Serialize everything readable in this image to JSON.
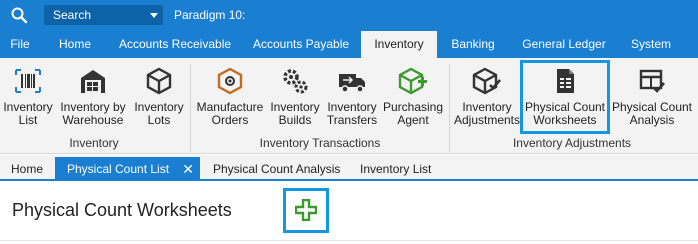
{
  "titlebar": {
    "search_label": "Search",
    "company_name": "Paradigm 10:",
    "bar_color": "#1a7fd0"
  },
  "menu": {
    "tabs": [
      {
        "label": "File"
      },
      {
        "label": "Home"
      },
      {
        "label": "Accounts Receivable"
      },
      {
        "label": "Accounts Payable"
      },
      {
        "label": "Inventory",
        "active": true
      },
      {
        "label": "Banking"
      },
      {
        "label": "General Ledger"
      },
      {
        "label": "System"
      }
    ]
  },
  "ribbon": {
    "groups": [
      {
        "label": "Inventory"
      },
      {
        "label": "Inventory Transactions"
      },
      {
        "label": "Inventory Adjustments"
      }
    ],
    "buttons": {
      "inventory_list": {
        "line1": "Inventory",
        "line2": "List",
        "icon": "barcode-icon"
      },
      "inventory_by_warehouse": {
        "line1": "Inventory by",
        "line2": "Warehouse",
        "icon": "warehouse-icon"
      },
      "inventory_lots": {
        "line1": "Inventory",
        "line2": "Lots",
        "icon": "box-icon"
      },
      "manufacture_orders": {
        "line1": "Manufacture",
        "line2": "Orders",
        "icon": "gear-box-icon"
      },
      "inventory_builds": {
        "line1": "Inventory",
        "line2": "Builds",
        "icon": "gears-icon"
      },
      "inventory_transfers": {
        "line1": "Inventory",
        "line2": "Transfers",
        "icon": "truck-icon"
      },
      "purchasing_agent": {
        "line1": "Purchasing",
        "line2": "Agent",
        "icon": "box-plus-icon"
      },
      "inventory_adjustments": {
        "line1": "Inventory",
        "line2": "Adjustments",
        "icon": "box-check-icon"
      },
      "physical_count_worksheets": {
        "line1": "Physical Count",
        "line2": "Worksheets",
        "icon": "worksheet-icon"
      },
      "physical_count_analysis": {
        "line1": "Physical Count",
        "line2": "Analysis",
        "icon": "table-check-icon"
      }
    }
  },
  "doc_tabs": [
    {
      "label": "Home"
    },
    {
      "label": "Physical Count List",
      "active": true,
      "close": "✕"
    },
    {
      "label": "Physical Count Analysis"
    },
    {
      "label": "Inventory List"
    }
  ],
  "content": {
    "title": "Physical Count Worksheets",
    "add_icon_color": "#3a9a2c"
  },
  "colors": {
    "accent": "#1a7fd0",
    "highlight": "#1596e0",
    "icon_orange": "#c26a1d",
    "icon_green": "#3a9a2c"
  }
}
